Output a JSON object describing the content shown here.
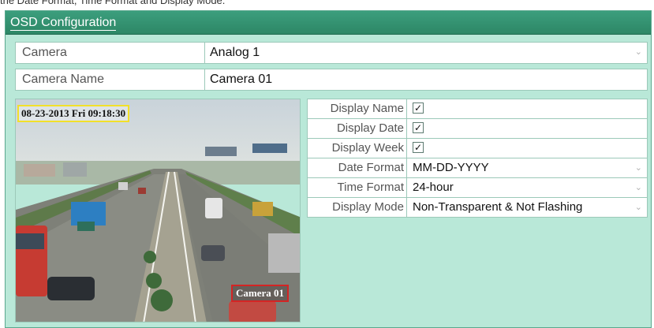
{
  "top_caption": "the Date Format, Time Format and Display Mode.",
  "panel": {
    "title": "OSD Configuration"
  },
  "camera": {
    "label": "Camera",
    "value": "Analog 1"
  },
  "camera_name": {
    "label": "Camera Name",
    "value": "Camera 01"
  },
  "preview": {
    "osd_datetime": "08-23-2013 Fri 09:18:30",
    "osd_camera_name": "Camera 01"
  },
  "options": {
    "display_name": {
      "label": "Display Name",
      "checked": true,
      "mark": "✓"
    },
    "display_date": {
      "label": "Display Date",
      "checked": true,
      "mark": "✓"
    },
    "display_week": {
      "label": "Display Week",
      "checked": true,
      "mark": "✓"
    },
    "date_format": {
      "label": "Date Format",
      "value": "MM-DD-YYYY"
    },
    "time_format": {
      "label": "Time Format",
      "value": "24-hour"
    },
    "display_mode": {
      "label": "Display Mode",
      "value": "Non-Transparent & Not Flashing"
    }
  },
  "icons": {
    "dropdown": "chevron-down-icon",
    "checkbox": "checkmark-icon"
  },
  "colors": {
    "panel_bg": "#b9e8d8",
    "header_bg": "#2d8766",
    "osd_date_border": "#f2e02a",
    "osd_name_border": "#d42424"
  }
}
